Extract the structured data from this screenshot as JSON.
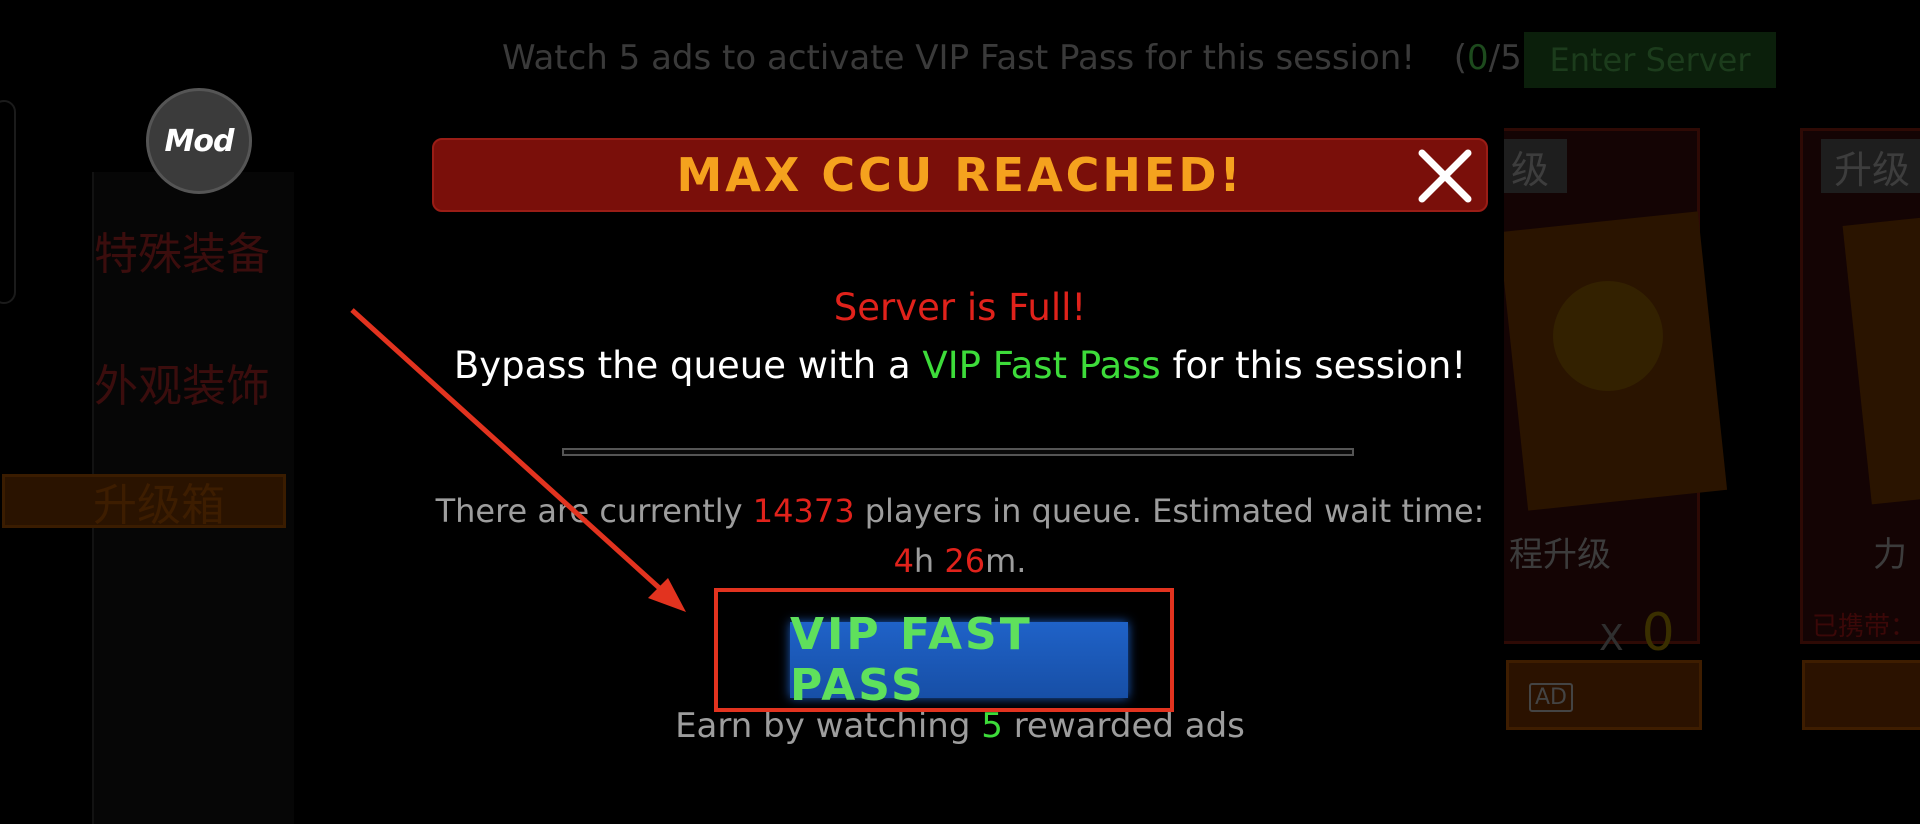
{
  "background": {
    "top_text": "Watch 5 ads to activate VIP Fast Pass for this session!",
    "top_counter_open": "(",
    "top_counter_value": "0",
    "top_counter_total": "/5)",
    "enter_button": "Enter Server",
    "mod_badge": "Mod",
    "side_items": [
      "特殊装备",
      "外观装饰",
      "升级箱"
    ],
    "card1": {
      "tag": "级",
      "label": "程升级",
      "count_prefix": "X",
      "count": "0",
      "ad": "AD"
    },
    "card2": {
      "tag": "升级",
      "label": "力",
      "sub": "已携带："
    }
  },
  "modal": {
    "title": "MAX CCU REACHED!",
    "server_full": "Server is Full!",
    "bypass_before": "Bypass the queue with a ",
    "bypass_vip": "VIP Fast Pass",
    "bypass_after": " for this session!",
    "progress": 0,
    "queue_before": "There are currently ",
    "queue_players": "14373",
    "queue_after": " players in queue. Estimated wait time:",
    "wait_hours": "4",
    "wait_h_unit": "h ",
    "wait_minutes": "26",
    "wait_m_unit": "m.",
    "vip_button": "VIP FAST PASS",
    "earn_before": "Earn by watching ",
    "earn_count": "5",
    "earn_after": " rewarded ads"
  },
  "colors": {
    "header_bg": "#7a0f0a",
    "title": "#f5a21e",
    "alert_red": "#e0221b",
    "vip_green": "#3ddc3a",
    "button_blue": "#1f62c8",
    "annotation_red": "#e2331f"
  },
  "icons": {
    "close": "close-icon",
    "arrow": "annotation-arrow"
  }
}
